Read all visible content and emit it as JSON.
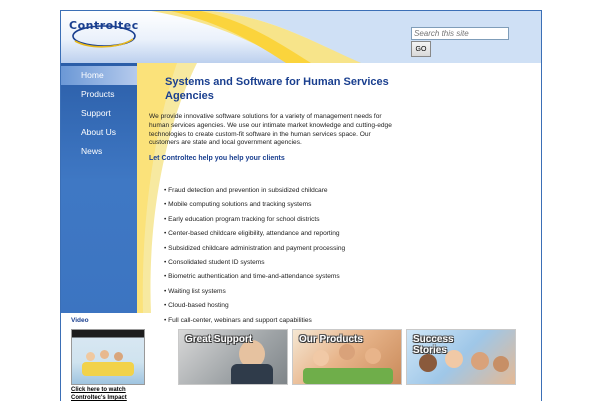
{
  "header": {
    "logo_text": "Controltec",
    "search_placeholder": "Search this site",
    "search_button": "GO"
  },
  "nav": {
    "items": [
      {
        "label": "Home"
      },
      {
        "label": "Products"
      },
      {
        "label": "Support"
      },
      {
        "label": "About Us"
      },
      {
        "label": "News"
      }
    ]
  },
  "video": {
    "label": "Video",
    "link_line1": "Click here to watch",
    "link_line2": "Controltec's Impact"
  },
  "main": {
    "title": "Systems and Software for Human Services Agencies",
    "intro": "We provide innovative software solutions for a variety of management needs for human services agencies. We use our intimate market knowledge and cutting-edge technologies to create custom-fit software in the human services space. Our customers are state and local government agencies.",
    "subhead": "Let Controltec help you help your clients",
    "bullets": [
      "• Fraud detection and prevention in subsidized childcare",
      "• Mobile computing solutions and tracking systems",
      "• Early education program tracking for school districts",
      "• Center-based childcare eligibility, attendance and reporting",
      "• Subsidized childcare administration and payment processing",
      "• Consolidated student ID systems",
      "• Biometric authentication and time-and-attendance systems",
      "• Waiting list systems",
      "• Cloud-based hosting",
      "• Full call-center, webinars and support capabilities"
    ]
  },
  "promos": [
    {
      "label": "Great Support"
    },
    {
      "label": "Our Products"
    },
    {
      "label": "Success Stories"
    }
  ],
  "colors": {
    "brand_blue": "#1a3f8f",
    "sidebar_blue": "#3a72bf",
    "accent_yellow": "#f6e37a"
  }
}
